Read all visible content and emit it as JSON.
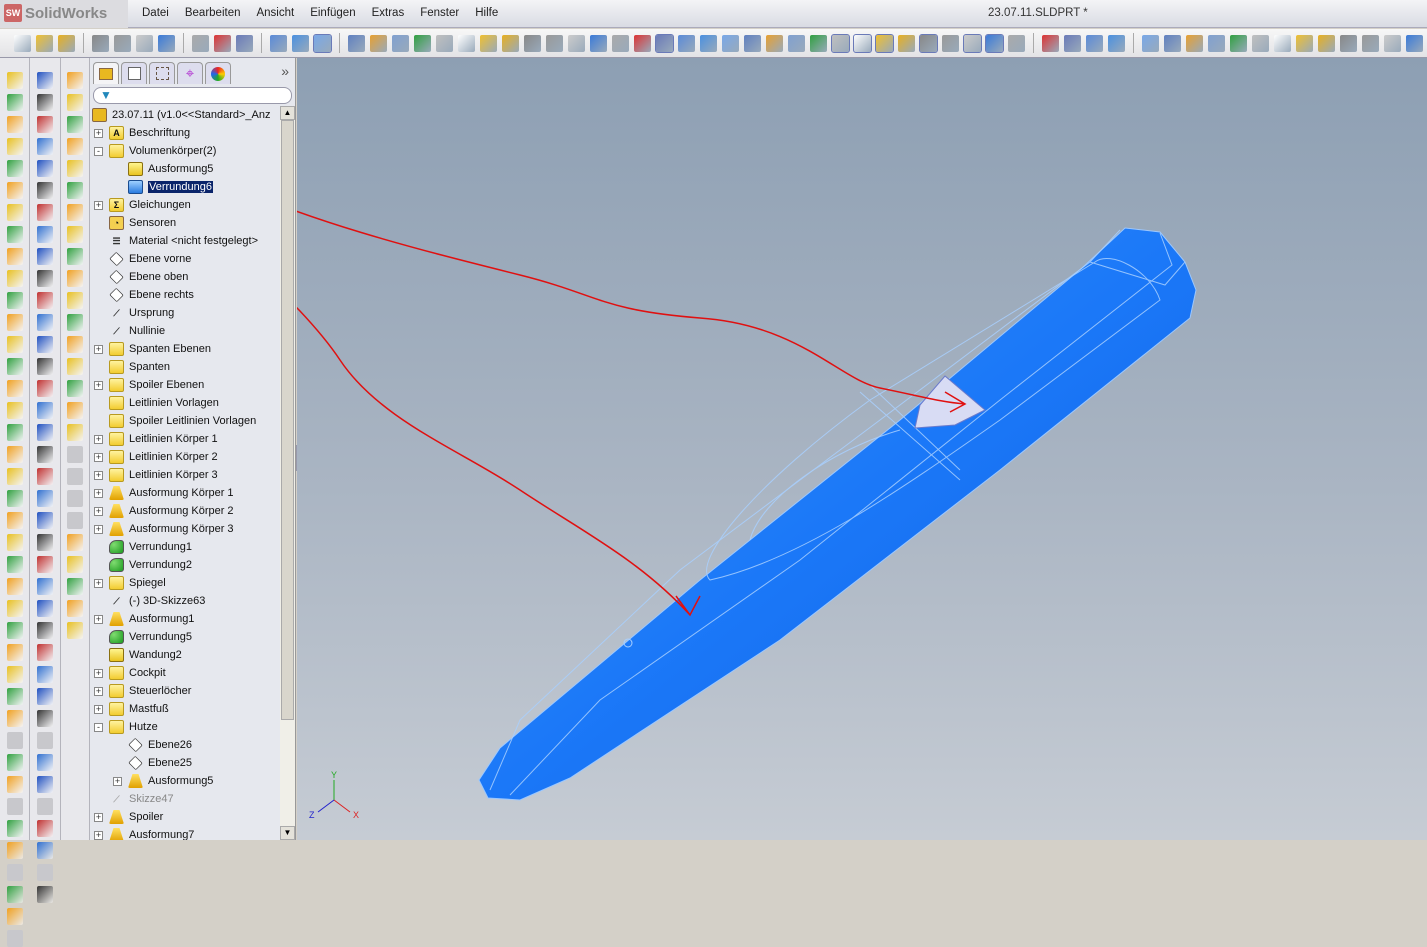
{
  "app": {
    "name": "SolidWorks",
    "document_title": "23.07.11.SLDPRT *"
  },
  "menu": [
    "Datei",
    "Bearbeiten",
    "Ansicht",
    "Einfügen",
    "Extras",
    "Fenster",
    "Hilfe"
  ],
  "tree": {
    "root": "23.07.11  (v1.0<<Standard>_Anz",
    "items": [
      {
        "label": "Beschriftung",
        "icon": "annotation-icon",
        "level": 0,
        "expander": "+"
      },
      {
        "label": "Volumenkörper(2)",
        "icon": "solid-bodies-folder-icon",
        "level": 0,
        "expander": "-"
      },
      {
        "label": "Ausformung5",
        "icon": "solid-body-icon",
        "level": 1,
        "expander": ""
      },
      {
        "label": "Verrundung6",
        "icon": "solid-body-selected-icon",
        "level": 1,
        "expander": "",
        "selected": true
      },
      {
        "label": "Gleichungen",
        "icon": "equations-icon",
        "level": 0,
        "expander": "+"
      },
      {
        "label": "Sensoren",
        "icon": "sensor-icon",
        "level": 0,
        "expander": ""
      },
      {
        "label": "Material <nicht festgelegt>",
        "icon": "material-icon",
        "level": 0,
        "expander": ""
      },
      {
        "label": "Ebene vorne",
        "icon": "plane-icon",
        "level": 0,
        "expander": ""
      },
      {
        "label": "Ebene oben",
        "icon": "plane-icon",
        "level": 0,
        "expander": ""
      },
      {
        "label": "Ebene rechts",
        "icon": "plane-icon",
        "level": 0,
        "expander": ""
      },
      {
        "label": "Ursprung",
        "icon": "origin-icon",
        "level": 0,
        "expander": ""
      },
      {
        "label": "Nullinie",
        "icon": "axis-icon",
        "level": 0,
        "expander": ""
      },
      {
        "label": "Spanten Ebenen",
        "icon": "folder-icon",
        "level": 0,
        "expander": "+"
      },
      {
        "label": "Spanten",
        "icon": "folder-icon",
        "level": 0,
        "expander": ""
      },
      {
        "label": "Spoiler Ebenen",
        "icon": "folder-icon",
        "level": 0,
        "expander": "+"
      },
      {
        "label": "Leitlinien Vorlagen",
        "icon": "folder-icon",
        "level": 0,
        "expander": ""
      },
      {
        "label": "Spoiler Leitlinien Vorlagen",
        "icon": "folder-icon",
        "level": 0,
        "expander": ""
      },
      {
        "label": "Leitlinien Körper 1",
        "icon": "folder-icon",
        "level": 0,
        "expander": "+"
      },
      {
        "label": "Leitlinien Körper 2",
        "icon": "folder-icon",
        "level": 0,
        "expander": "+"
      },
      {
        "label": "Leitlinien Körper 3",
        "icon": "folder-icon",
        "level": 0,
        "expander": "+"
      },
      {
        "label": "Ausformung Körper 1",
        "icon": "loft-icon",
        "level": 0,
        "expander": "+"
      },
      {
        "label": "Ausformung Körper 2",
        "icon": "loft-icon",
        "level": 0,
        "expander": "+"
      },
      {
        "label": "Ausformung Körper 3",
        "icon": "loft-icon",
        "level": 0,
        "expander": "+"
      },
      {
        "label": "Verrundung1",
        "icon": "fillet-icon",
        "level": 0,
        "expander": ""
      },
      {
        "label": "Verrundung2",
        "icon": "fillet-icon",
        "level": 0,
        "expander": ""
      },
      {
        "label": "Spiegel",
        "icon": "folder-icon",
        "level": 0,
        "expander": "+"
      },
      {
        "label": "(-) 3D-Skizze63",
        "icon": "3d-sketch-icon",
        "level": 0,
        "expander": ""
      },
      {
        "label": "Ausformung1",
        "icon": "loft-icon",
        "level": 0,
        "expander": "+"
      },
      {
        "label": "Verrundung5",
        "icon": "fillet-icon",
        "level": 0,
        "expander": ""
      },
      {
        "label": "Wandung2",
        "icon": "shell-icon",
        "level": 0,
        "expander": ""
      },
      {
        "label": "Cockpit",
        "icon": "folder-icon",
        "level": 0,
        "expander": "+"
      },
      {
        "label": "Steuerlöcher",
        "icon": "folder-icon",
        "level": 0,
        "expander": "+"
      },
      {
        "label": "Mastfuß",
        "icon": "folder-icon",
        "level": 0,
        "expander": "+"
      },
      {
        "label": "Hutze",
        "icon": "folder-icon",
        "level": 0,
        "expander": "-"
      },
      {
        "label": "Ebene26",
        "icon": "plane-icon",
        "level": 1,
        "expander": ""
      },
      {
        "label": "Ebene25",
        "icon": "plane-icon",
        "level": 1,
        "expander": ""
      },
      {
        "label": "Ausformung5",
        "icon": "loft-icon",
        "level": 1,
        "expander": "+"
      },
      {
        "label": "Skizze47",
        "icon": "sketch-icon",
        "level": 0,
        "expander": "",
        "grey": true
      },
      {
        "label": "Spoiler",
        "icon": "loft-icon",
        "level": 0,
        "expander": "+"
      },
      {
        "label": "Ausformung7",
        "icon": "loft-icon",
        "level": 0,
        "expander": "+"
      }
    ]
  },
  "triad": {
    "x": "X",
    "y": "Y",
    "z": "Z"
  },
  "colors": {
    "model": "#1e7cff",
    "annotation": "#e01010",
    "selection": "#0a246a"
  }
}
